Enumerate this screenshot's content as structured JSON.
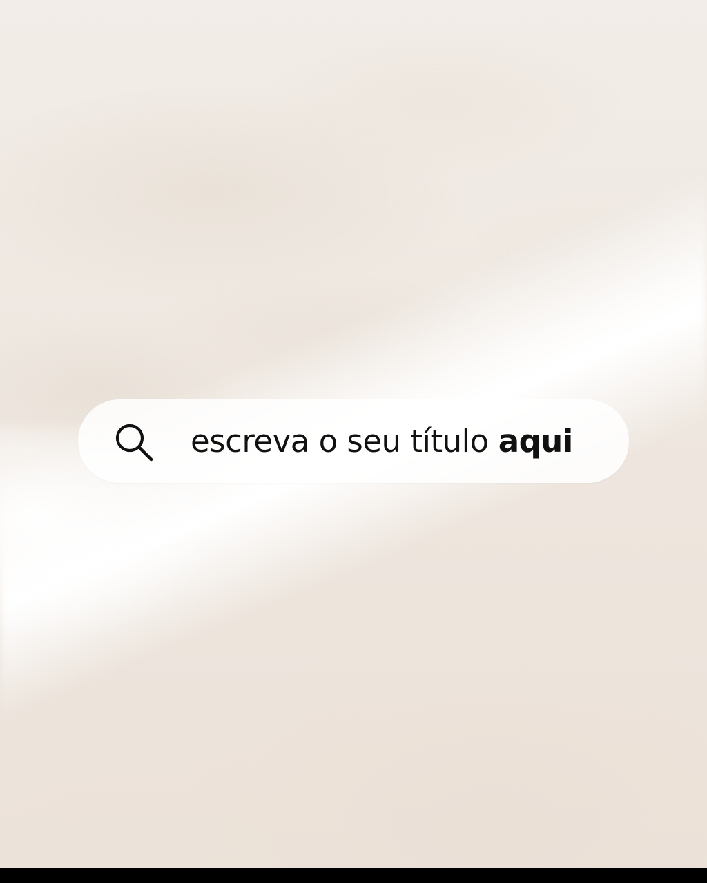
{
  "search": {
    "icon": "search-icon",
    "title_regular": "escreva o seu título",
    "title_bold": "aqui"
  },
  "colors": {
    "sand": "#ece3db",
    "foam": "#ffffff",
    "bar_background": "#fbfaf8",
    "text": "#111111",
    "bottom_strip": "#000000"
  }
}
